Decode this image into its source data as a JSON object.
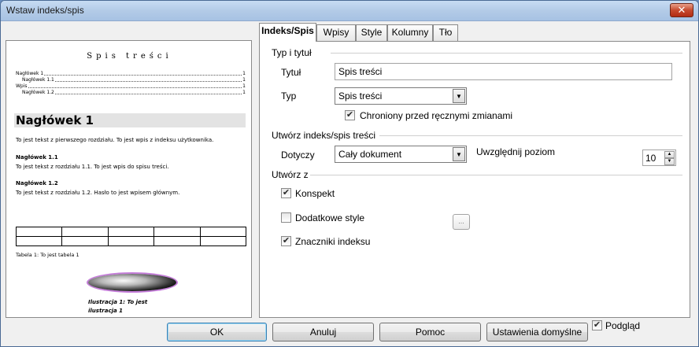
{
  "window": {
    "title": "Wstaw indeks/spis",
    "close_glyph": "✕"
  },
  "tabs": [
    {
      "label": "Indeks/Spis"
    },
    {
      "label": "Wpisy"
    },
    {
      "label": "Style"
    },
    {
      "label": "Kolumny"
    },
    {
      "label": "Tło"
    }
  ],
  "preview": {
    "title": "Spis treści",
    "toc": [
      {
        "text": "Nagłówek 1",
        "page": "1"
      },
      {
        "text": "Nagłówek 1.1",
        "page": "1"
      },
      {
        "text": "Wpis",
        "page": "1"
      },
      {
        "text": "Nagłówek 1.2",
        "page": "1"
      }
    ],
    "heading": "Nagłówek 1",
    "para1": "To jest tekst z pierwszego rozdziału. To jest wpis z indeksu użytkownika.",
    "sub1_title": "Nagłówek 1.1",
    "sub1_text": "To jest tekst z rozdziału 1.1. To jest wpis do spisu treści.",
    "sub2_title": "Nagłówek 1.2",
    "sub2_text": "To jest tekst z rozdziału 1.2. Hasło to jest wpisem głównym.",
    "table_caption": "Tabela 1: To jest tabela 1",
    "image_caption_line1": "Ilustracja 1: To jest",
    "image_caption_line2": "ilustracja 1"
  },
  "type_section": {
    "heading": "Typ i tytuł",
    "title_label": "Tytuł",
    "title_value": "Spis treści",
    "type_label": "Typ",
    "type_value": "Spis treści",
    "protected_label": "Chroniony przed ręcznymi zmianami",
    "protected_checked": true
  },
  "create_section": {
    "heading": "Utwórz indeks/spis treści",
    "for_label": "Dotyczy",
    "for_value": "Cały dokument",
    "level_label": "Uwzględnij poziom",
    "level_value": "10"
  },
  "create_from": {
    "heading": "Utwórz z",
    "outline_label": "Konspekt",
    "outline_checked": true,
    "additional_label": "Dodatkowe style",
    "additional_checked": false,
    "additional_button": "...",
    "marks_label": "Znaczniki indeksu",
    "marks_checked": true
  },
  "buttons": {
    "ok": "OK",
    "cancel": "Anuluj",
    "help": "Pomoc",
    "reset": "Ustawienia domyślne",
    "preview_label": "Podgląd",
    "preview_checked": true
  }
}
